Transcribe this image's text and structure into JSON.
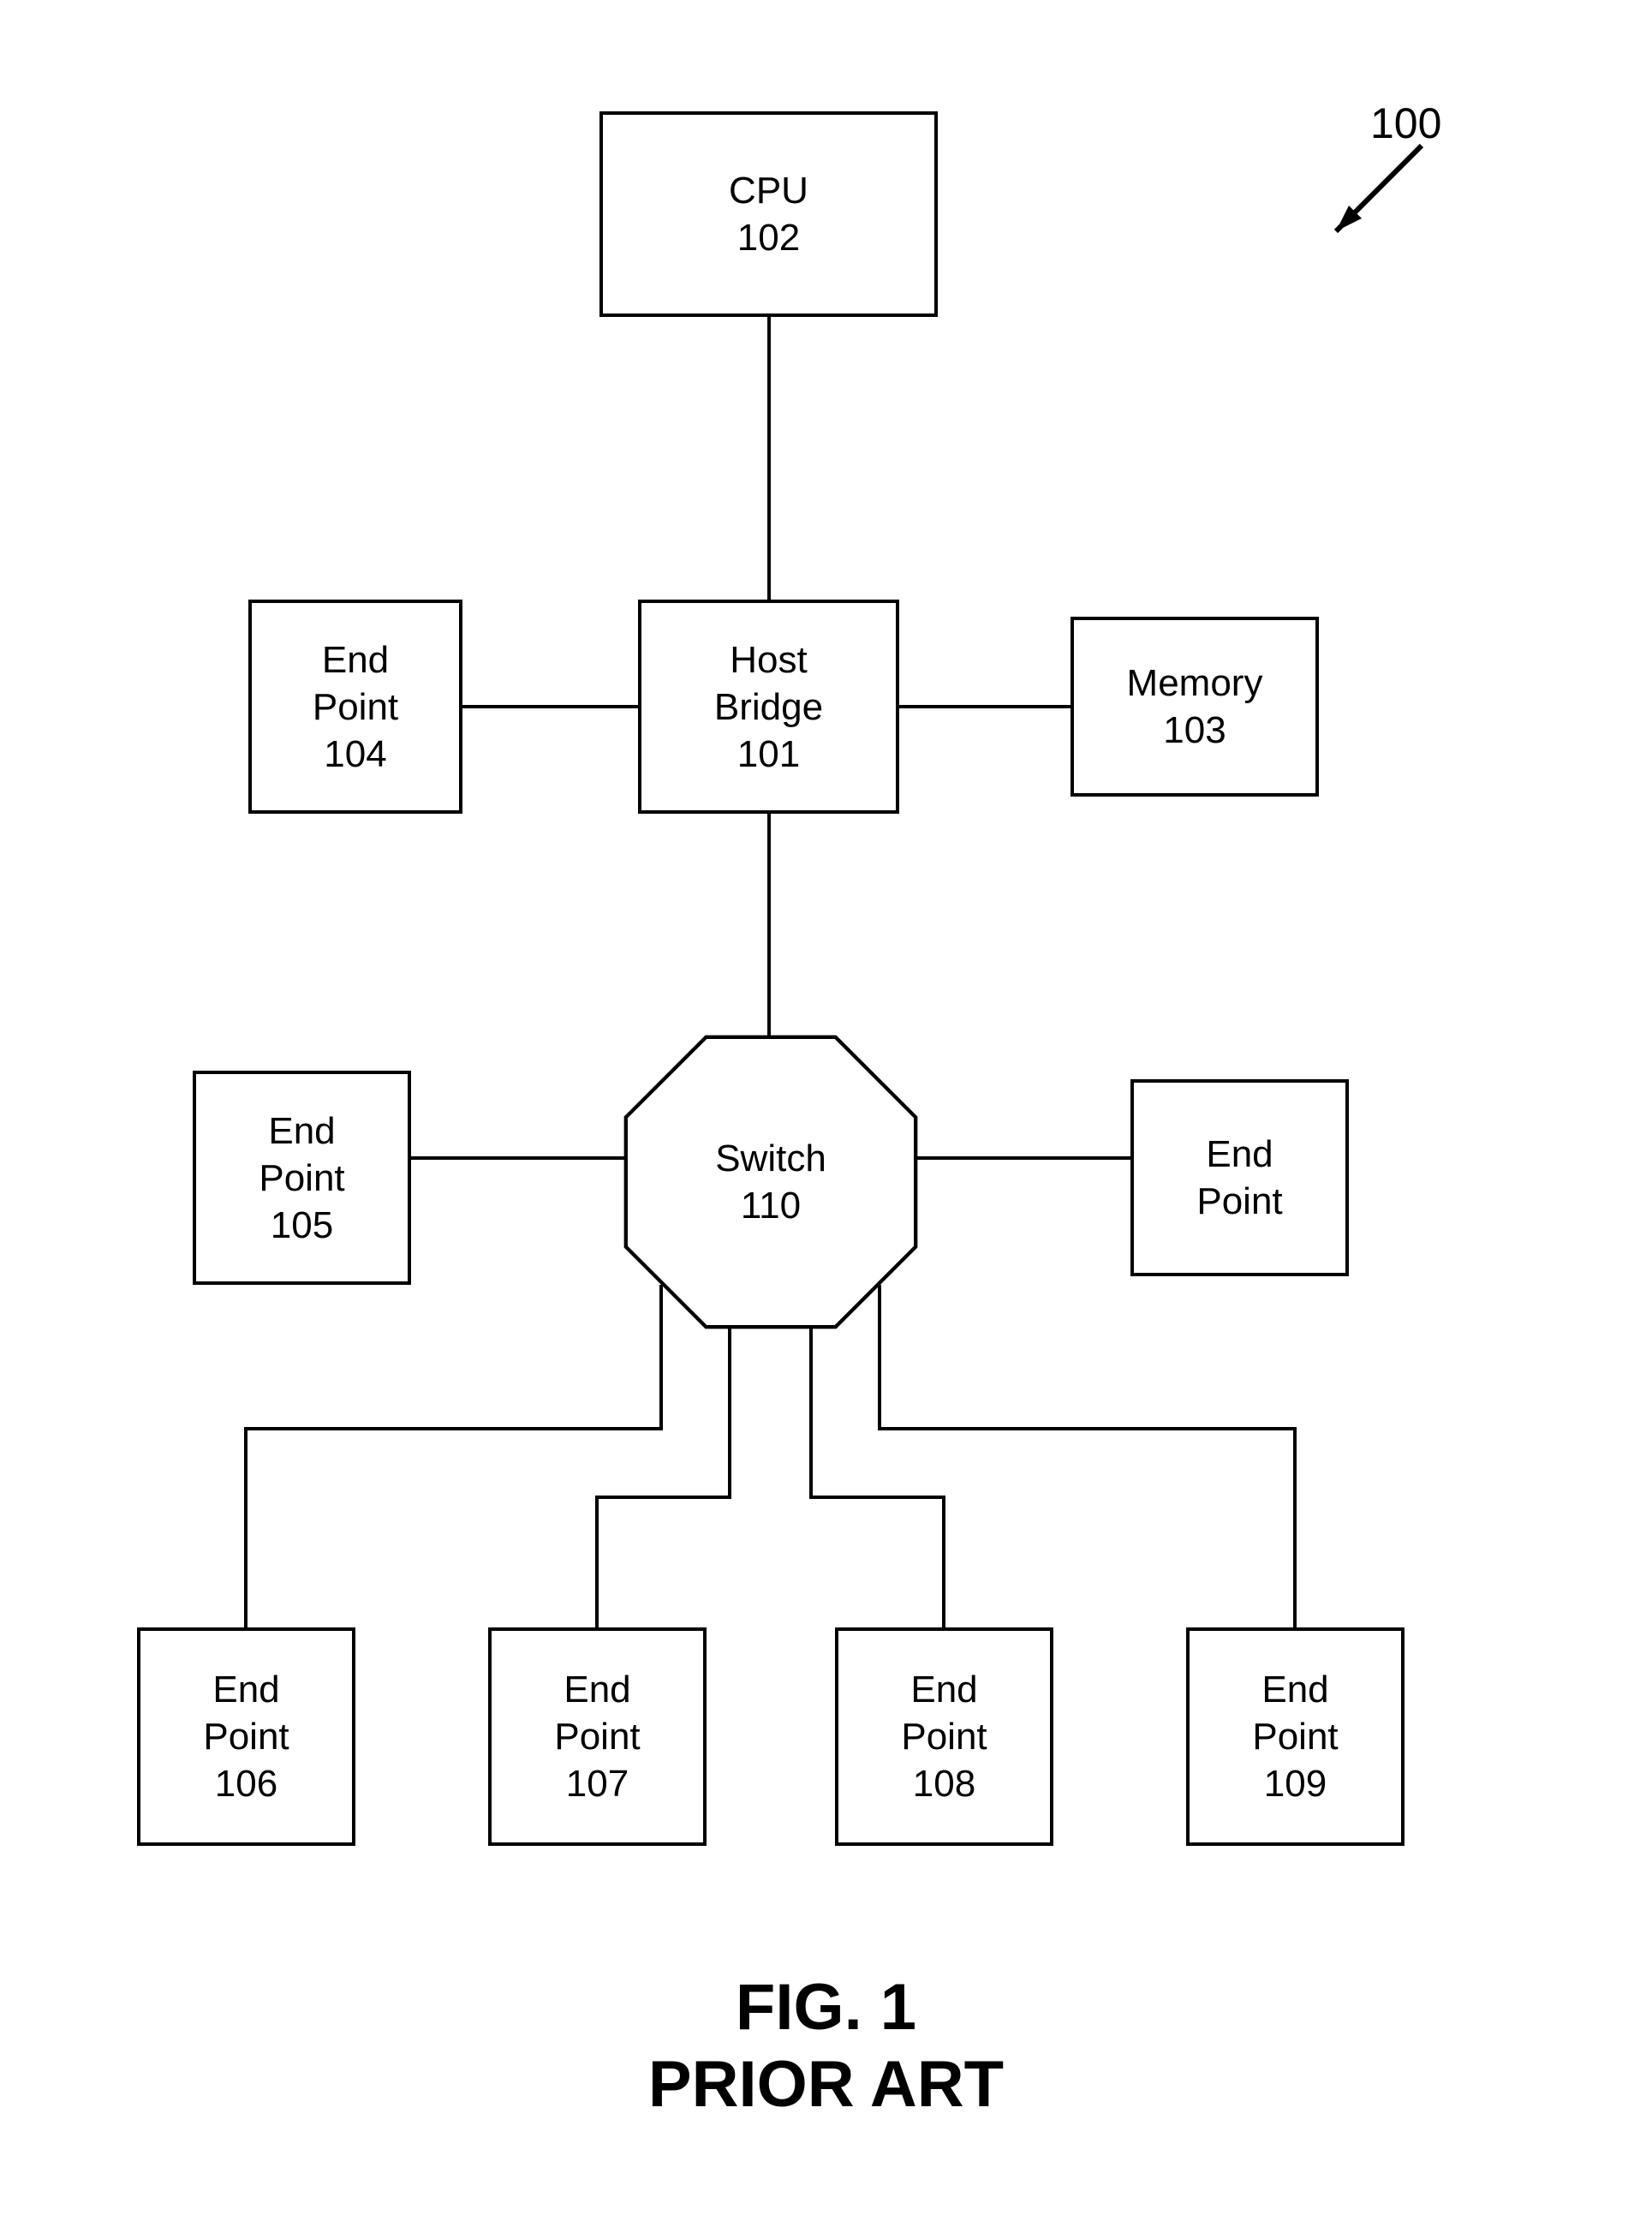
{
  "figure_ref": "100",
  "caption_line1": "FIG. 1",
  "caption_line2": "PRIOR ART",
  "nodes": {
    "cpu": {
      "line1": "CPU",
      "line2": "102"
    },
    "hostbridge": {
      "line1": "Host",
      "line2": "Bridge",
      "line3": "101"
    },
    "memory": {
      "line1": "Memory",
      "line2": "103"
    },
    "ep104": {
      "line1": "End",
      "line2": "Point",
      "line3": "104"
    },
    "ep105": {
      "line1": "End",
      "line2": "Point",
      "line3": "105"
    },
    "switch": {
      "line1": "Switch",
      "line2": "110"
    },
    "ep_right": {
      "line1": "End",
      "line2": "Point"
    },
    "ep106": {
      "line1": "End",
      "line2": "Point",
      "line3": "106"
    },
    "ep107": {
      "line1": "End",
      "line2": "Point",
      "line3": "107"
    },
    "ep108": {
      "line1": "End",
      "line2": "Point",
      "line3": "108"
    },
    "ep109": {
      "line1": "End",
      "line2": "Point",
      "line3": "109"
    }
  }
}
